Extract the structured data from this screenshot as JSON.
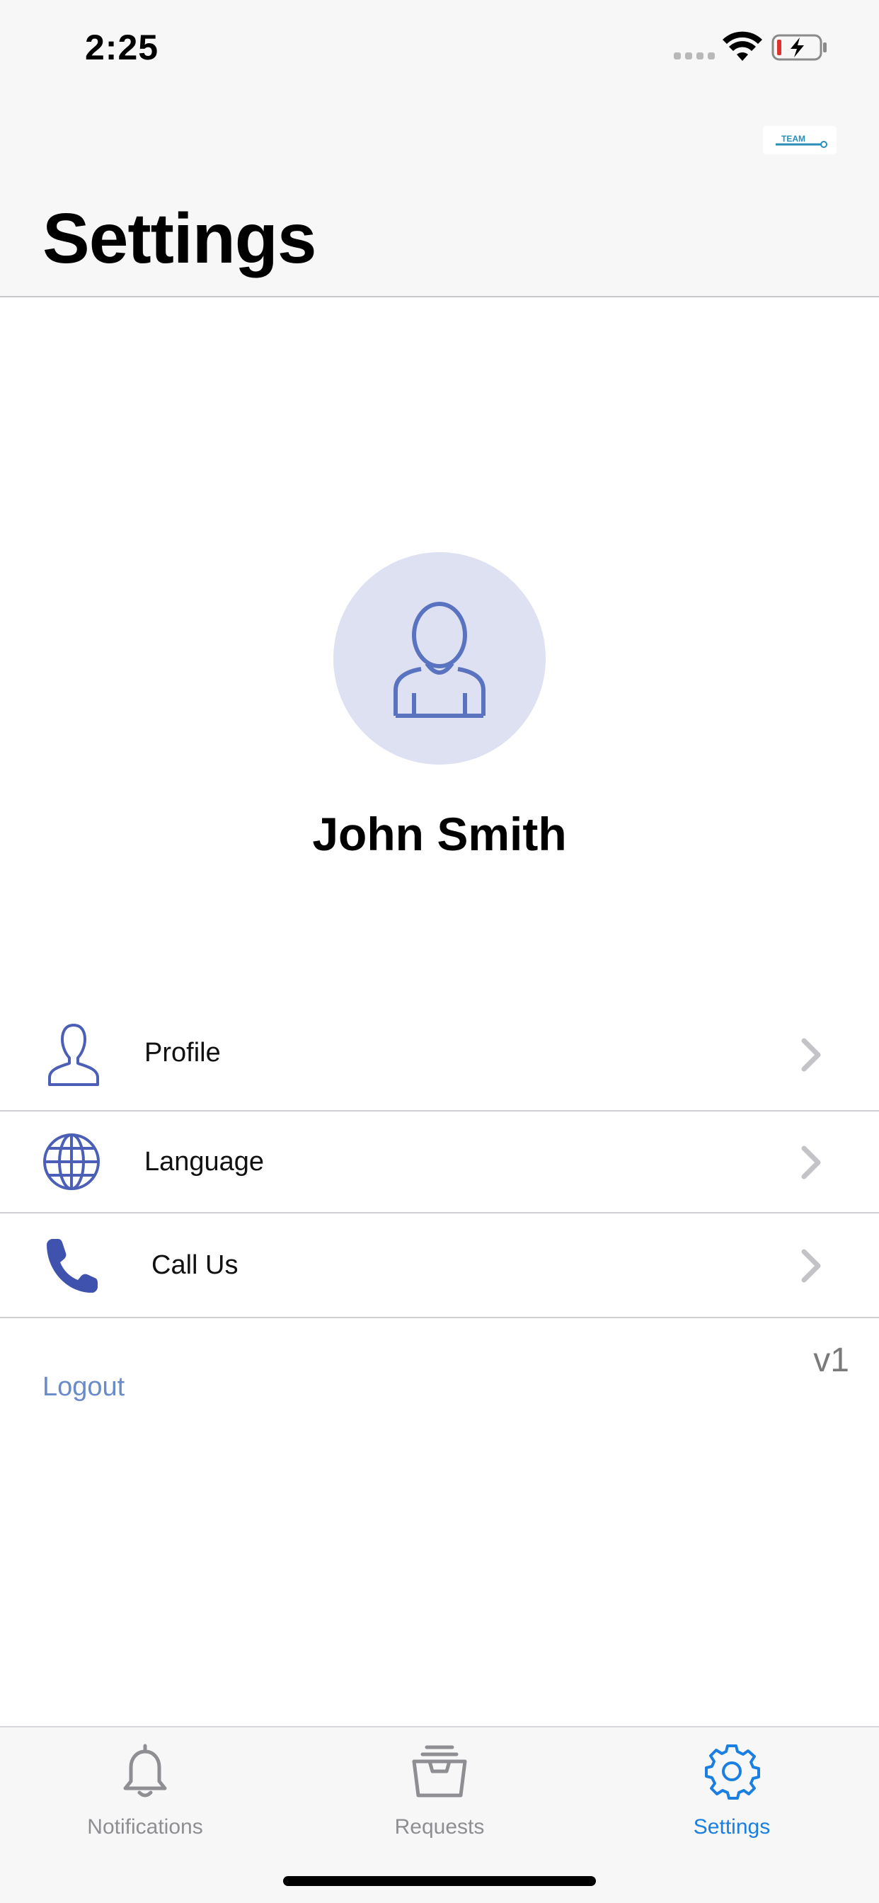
{
  "status_bar": {
    "time": "2:25"
  },
  "header": {
    "title": "Settings",
    "logo_text": "TEAM"
  },
  "user": {
    "name": "John Smith"
  },
  "menu": {
    "items": [
      {
        "label": "Profile",
        "icon": "person-outline-icon"
      },
      {
        "label": "Language",
        "icon": "globe-icon"
      },
      {
        "label": "Call Us",
        "icon": "phone-icon"
      }
    ]
  },
  "logout_label": "Logout",
  "version": "v1",
  "tab_bar": {
    "tabs": [
      {
        "label": "Notifications",
        "icon": "bell-icon",
        "active": false
      },
      {
        "label": "Requests",
        "icon": "tray-icon",
        "active": false
      },
      {
        "label": "Settings",
        "icon": "gear-icon",
        "active": true
      }
    ]
  },
  "colors": {
    "accent": "#1a7fe0",
    "icon_blue": "#4a5fb5",
    "avatar_bg": "#dde1f1",
    "logout": "#6a8bc9",
    "inactive_tab": "#8e8e93"
  }
}
